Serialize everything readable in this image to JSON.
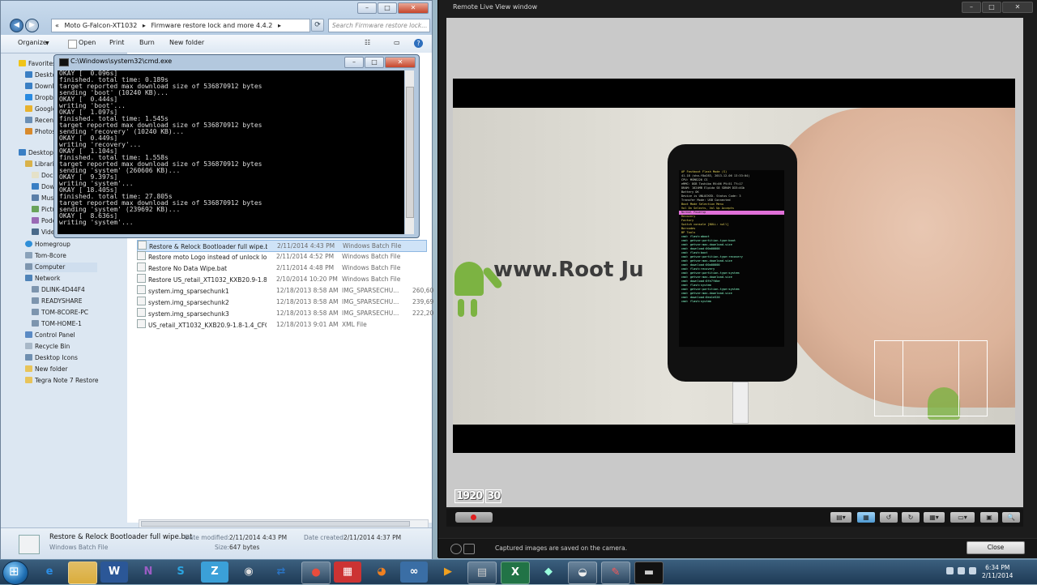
{
  "explorer": {
    "address_path": [
      "Moto G-Falcon-XT1032",
      "Firmware restore lock and more 4.4.2"
    ],
    "search_placeholder": "Search Firmware restore lock...",
    "toolbar": {
      "organize": "Organize",
      "open": "Open",
      "print": "Print",
      "burn": "Burn",
      "new_folder": "New folder"
    },
    "nav": {
      "favorites": "Favorites",
      "fav_items": [
        "Desktop",
        "Downloads",
        "Dropbox",
        "Google Drive",
        "Recent Places",
        "Photos"
      ],
      "desktop": "Desktop",
      "libraries": "Libraries",
      "lib_items": [
        "Documents",
        "Downloads",
        "Music",
        "Pictures",
        "Podcasts",
        "Videos"
      ],
      "homegroup": "Homegroup",
      "tom8core": "Tom-8core",
      "computer": "Computer",
      "network": "Network",
      "net_items": [
        "DLINK-4D44F4",
        "READYSHARE",
        "TOM-8CORE-PC",
        "TOM-HOME-1"
      ],
      "other_items": [
        "Control Panel",
        "Recycle Bin",
        "Desktop Icons",
        "New folder",
        "Tegra Note 7 Restore"
      ]
    },
    "files": [
      {
        "name": "Restore & Relock Bootloader full wipe.bat",
        "date": "2/11/2014 4:43 PM",
        "type": "Windows Batch File",
        "size": ""
      },
      {
        "name": "Restore moto Logo instead of unlock log...",
        "date": "2/11/2014 4:52 PM",
        "type": "Windows Batch File",
        "size": ""
      },
      {
        "name": "Restore No Data Wipe.bat",
        "date": "2/11/2014 4:48 PM",
        "type": "Windows Batch File",
        "size": ""
      },
      {
        "name": "Restore US_retail_XT1032_KXB20.9-1.8-1.4...",
        "date": "2/10/2014 10:20 PM",
        "type": "Windows Batch File",
        "size": ""
      },
      {
        "name": "system.img_sparsechunk1",
        "date": "12/18/2013 8:58 AM",
        "type": "IMG_SPARSECHU...",
        "size": "260,60"
      },
      {
        "name": "system.img_sparsechunk2",
        "date": "12/18/2013 8:58 AM",
        "type": "IMG_SPARSECHU...",
        "size": "239,69"
      },
      {
        "name": "system.img_sparsechunk3",
        "date": "12/18/2013 8:58 AM",
        "type": "IMG_SPARSECHU...",
        "size": "222,20"
      },
      {
        "name": "US_retail_XT1032_KXB20.9-1.8-1.4_CFC.xml",
        "date": "12/18/2013 9:01 AM",
        "type": "XML File",
        "size": ""
      }
    ],
    "details": {
      "filename": "Restore & Relock Bootloader full wipe.bat",
      "filetype": "Windows Batch File",
      "modified_label": "Date modified:",
      "modified": "2/11/2014 4:43 PM",
      "created_label": "Date created:",
      "created": "2/11/2014 4:37 PM",
      "size_label": "Size:",
      "size": "647 bytes"
    }
  },
  "cmd": {
    "title": "C:\\Windows\\system32\\cmd.exe",
    "lines": [
      "OKAY [  0.096s]",
      "finished. total time: 0.189s",
      "target reported max download size of 536870912 bytes",
      "sending 'boot' (10240 KB)...",
      "OKAY [  0.444s]",
      "writing 'boot'...",
      "OKAY [  1.097s]",
      "finished. total time: 1.545s",
      "target reported max download size of 536870912 bytes",
      "sending 'recovery' (10240 KB)...",
      "OKAY [  0.449s]",
      "writing 'recovery'...",
      "OKAY [  1.104s]",
      "finished. total time: 1.558s",
      "target reported max download size of 536870912 bytes",
      "sending 'system' (260606 KB)...",
      "OKAY [  9.397s]",
      "writing 'system'...",
      "OKAY [ 18.405s]",
      "finished. total time: 27.805s",
      "target reported max download size of 536870912 bytes",
      "sending 'system' (239692 KB)...",
      "OKAY [  8.636s]",
      "writing 'system'..."
    ]
  },
  "liveview": {
    "title": "Remote Live View window",
    "photo_text": "www.Root Ju",
    "phone_screen": {
      "header": [
        "AP Fastboot Flash Mode (S)",
        "41.18 (sha-f8a283, 2013-12-06 13:33:04)",
        "CPU: MSM8226 CS",
        "eMMC: 8GB Toshiba RV=06 PV=51 TY=17",
        "DRAM: 1024MB Elpida S8 SDRAM DIE=4Gb",
        "Battery OK",
        "Device is UNLOCKED.  Status Code: 3",
        "Transfer Mode: USB Connected"
      ],
      "menu_title": "Boot Mode Selection Menu",
      "menu_hint": "  Vol Dn Selects, Vol Up Accepts",
      "menu_items": [
        "Normal Powerup",
        "Recovery",
        "Factory",
        "Switch console [NULL: null]",
        "Barcodes",
        "BP Tools"
      ],
      "log": [
        "cmd: flash:aboot",
        "cmd: getvar:partition-type:boot",
        "cmd: getvar:max-download-size",
        "cmd: download:00a00000",
        "cmd: flash:boot",
        "cmd: getvar:partition-type:recovery",
        "cmd: getvar:max-download-size",
        "cmd: download:00a00000",
        "cmd: flash:recovery",
        "cmd: getvar:partition-type:system",
        "cmd: getvar:max-download-size",
        "cmd: download:0fe7fdbe",
        "cmd: flash:system",
        "cmd: getvar:partition-type:system",
        "cmd: getvar:max-download-size",
        "cmd: download:0ea1e520",
        "cmd: flash:system"
      ]
    },
    "resolution": [
      "1920",
      "30"
    ],
    "status_message": "Captured images are saved on the camera.",
    "close_label": "Close"
  },
  "taskbar": {
    "apps": [
      "e",
      "W",
      "S",
      "Z",
      "X"
    ],
    "time": "6:34 PM",
    "date": "2/11/2014"
  }
}
